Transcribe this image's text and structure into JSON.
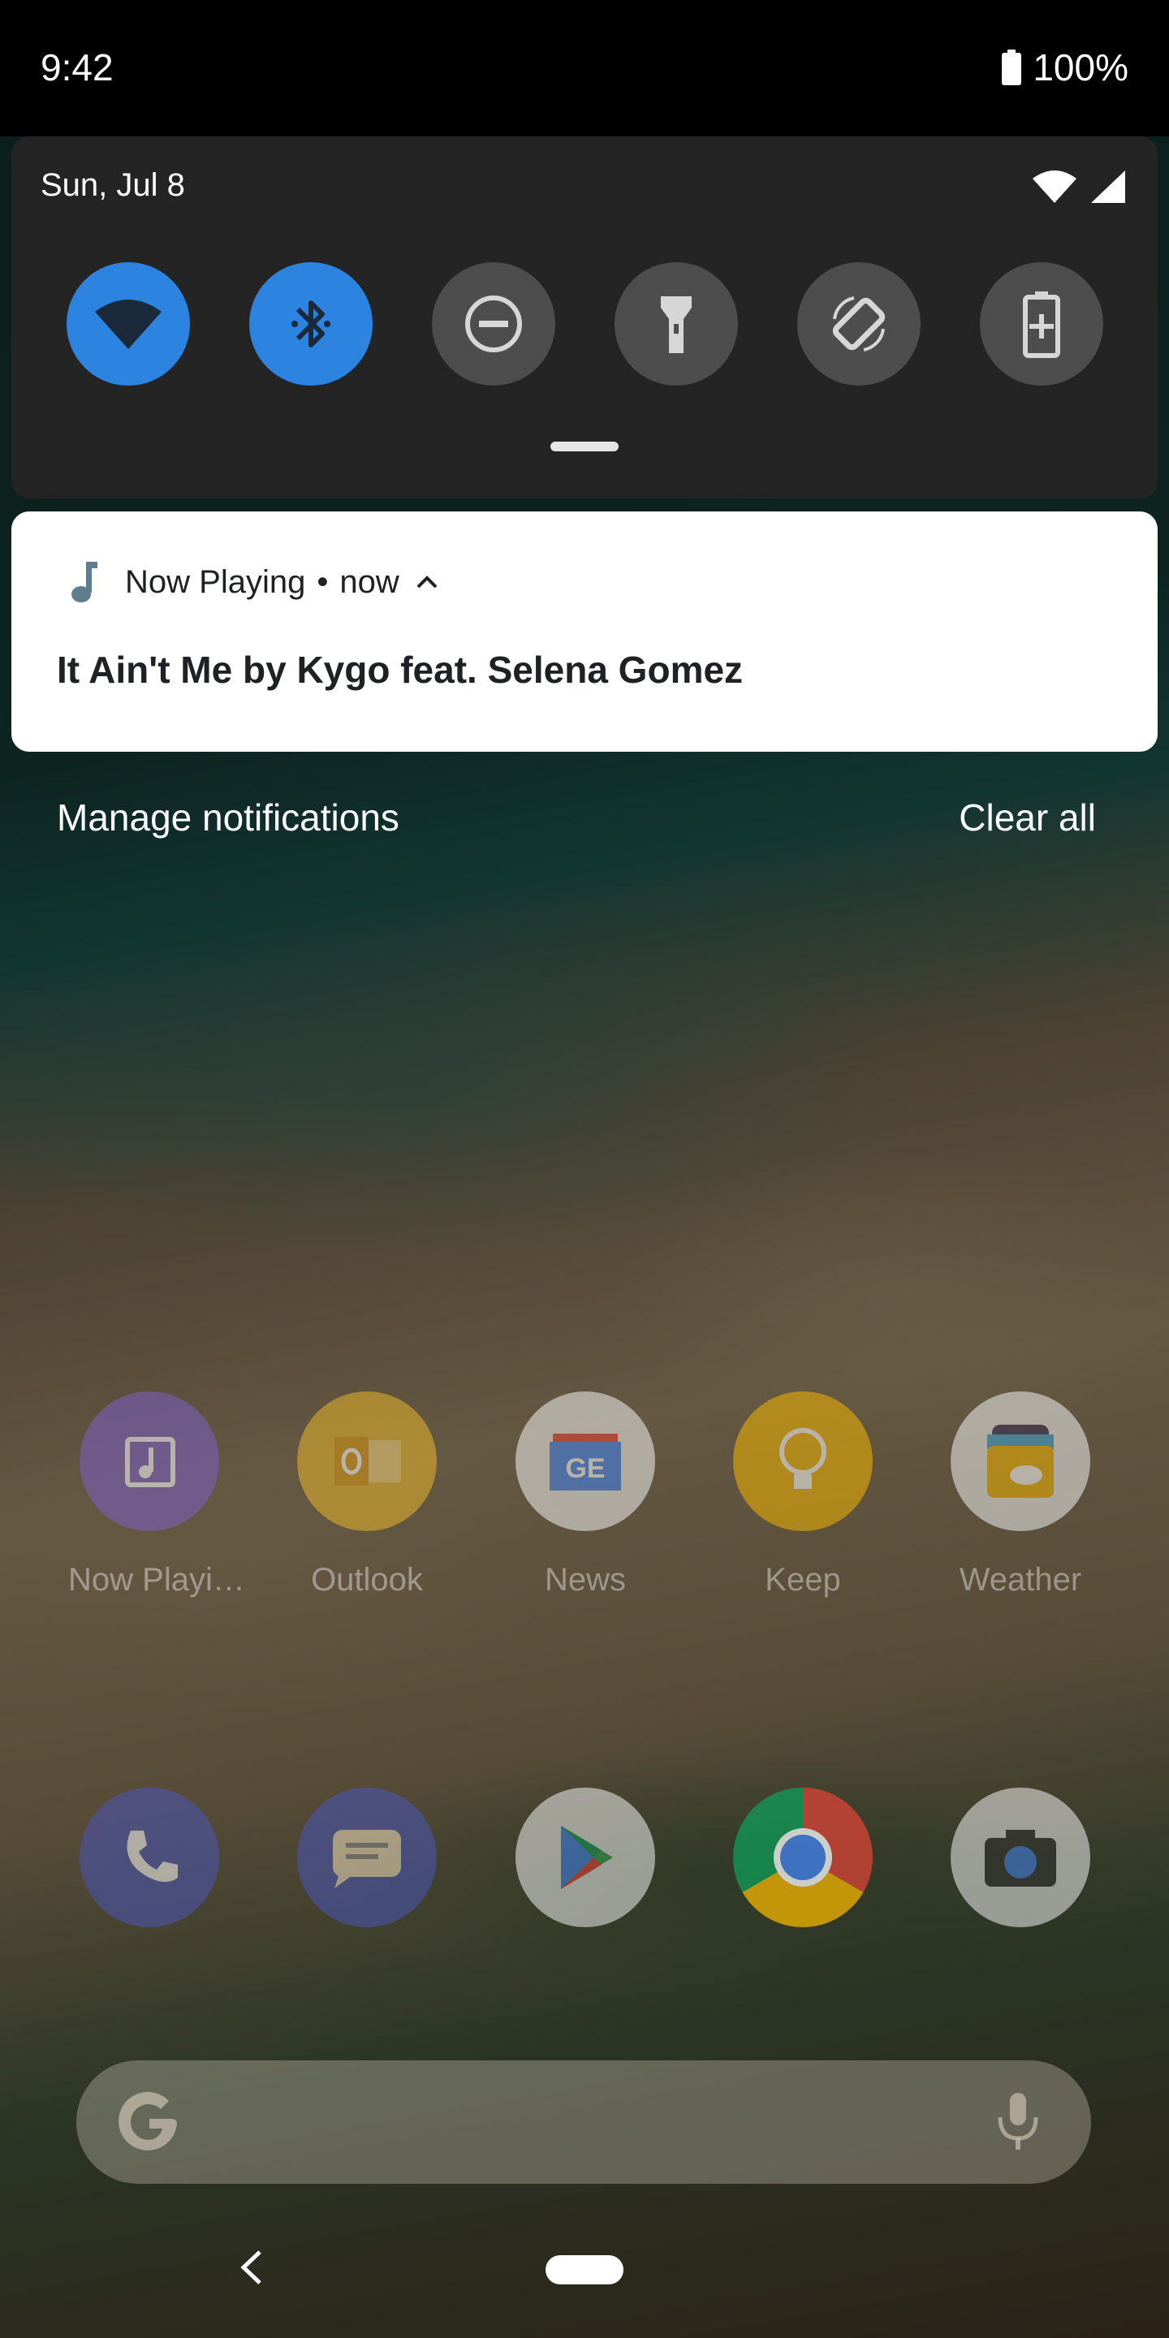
{
  "status_bar": {
    "time": "9:42",
    "battery": "100%"
  },
  "quick_settings": {
    "date": "Sun, Jul 8",
    "tiles": [
      {
        "name": "wifi",
        "state": "on",
        "icon": "wifi-icon"
      },
      {
        "name": "bluetooth",
        "state": "on",
        "icon": "bluetooth-icon"
      },
      {
        "name": "do-not-disturb",
        "state": "off",
        "icon": "do-not-disturb-icon"
      },
      {
        "name": "flashlight",
        "state": "off",
        "icon": "flashlight-icon"
      },
      {
        "name": "auto-rotate",
        "state": "off",
        "icon": "auto-rotate-icon"
      },
      {
        "name": "battery-saver",
        "state": "off",
        "icon": "battery-saver-icon"
      }
    ],
    "colors": {
      "active": "#2c83e0",
      "inactive": "#4d4d4d",
      "panel": "#242424"
    }
  },
  "notification": {
    "app_name": "Now Playing",
    "separator": "•",
    "time": "now",
    "title": "It Ain't Me by Kygo feat. Selena Gomez"
  },
  "actions": {
    "manage": "Manage notifications",
    "clear": "Clear all"
  },
  "apps": {
    "row1": [
      "Now Playi…",
      "Outlook",
      "News",
      "Keep",
      "Weather"
    ],
    "dock": [
      "phone-icon",
      "messages-icon",
      "play-store-icon",
      "chrome-icon",
      "camera-icon"
    ]
  }
}
